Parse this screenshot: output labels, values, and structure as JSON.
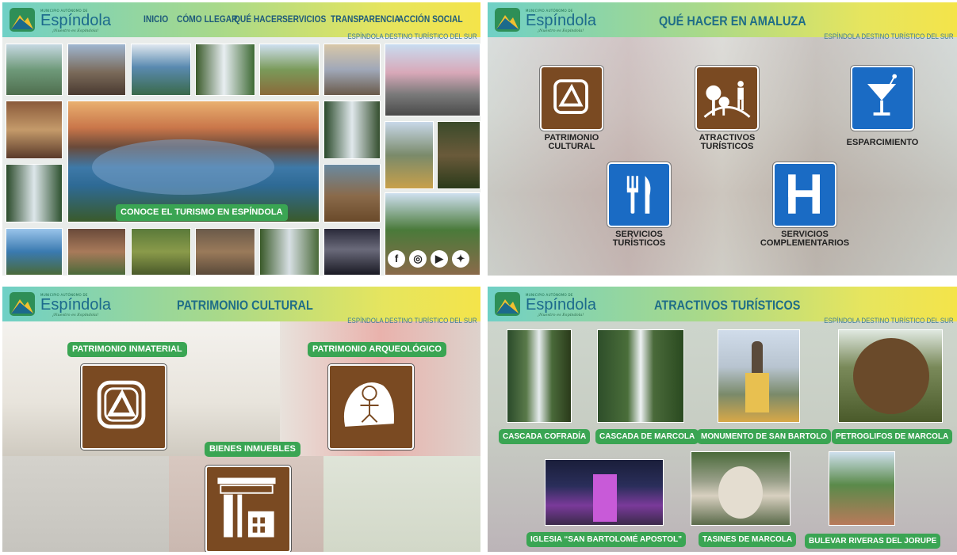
{
  "brand": {
    "name": "Espíndola",
    "mini_caption": "MUNICIPIO AUTÓNOMO DE",
    "tagline": "¡Nuestro es Espíndola!",
    "subtitle": "ESPÍNDOLA DESTINO TURÍSTICO DEL SUR"
  },
  "home": {
    "nav": [
      "INICIO",
      "CÓMO LLEGAR",
      "QUÉ HACER",
      "SERVICIOS",
      "TRANSPARENCIA",
      "ACCIÓN SOCIAL"
    ],
    "cta": "CONOCE EL TURISMO EN ESPÍNDOLA",
    "social_icons": [
      "facebook-icon",
      "instagram-icon",
      "youtube-icon",
      "twitter-icon"
    ]
  },
  "que_hacer": {
    "title": "QUÉ HACER EN AMALUZA",
    "items": [
      {
        "label_1": "PATRIMONIO",
        "label_2": "CULTURAL",
        "icon": "archaeological-site-icon"
      },
      {
        "label_1": "ATRACTIVOS",
        "label_2": "TURÍSTICOS",
        "icon": "nature-attraction-icon"
      },
      {
        "label_1": "ESPARCIMIENTO",
        "label_2": "",
        "icon": "cocktail-glass-icon"
      },
      {
        "label_1": "SERVICIOS",
        "label_2": "TURÍSTICOS",
        "icon": "fork-knife-icon"
      },
      {
        "label_1": "SERVICIOS",
        "label_2": "COMPLEMENTARIOS",
        "icon": "hospital-h-icon"
      }
    ]
  },
  "patrimonio": {
    "title": "PATRIMONIO CULTURAL",
    "items": [
      "PATRIMONIO INMATERIAL",
      "PATRIMONIO ARQUEOLÓGICO",
      "BIENES INMUEBLES"
    ]
  },
  "atractivos": {
    "title": "ATRACTIVOS TURÍSTICOS",
    "items": [
      "CASCADA COFRADÍA",
      "CASCADA DE MARCOLA",
      "MONUMENTO DE SAN BARTOLO",
      "PETROGLIFOS DE MARCOLA",
      "IGLESIA “SAN BARTOLOMÉ APOSTOL”",
      "TASINES DE MARCOLA",
      "BULEVAR RIVERAS DEL JORUPE"
    ]
  },
  "colors": {
    "accent_green": "#3aa553",
    "sign_brown": "#7a4a22",
    "sign_blue": "#1a6bc4",
    "title_teal": "#1f6d87"
  }
}
